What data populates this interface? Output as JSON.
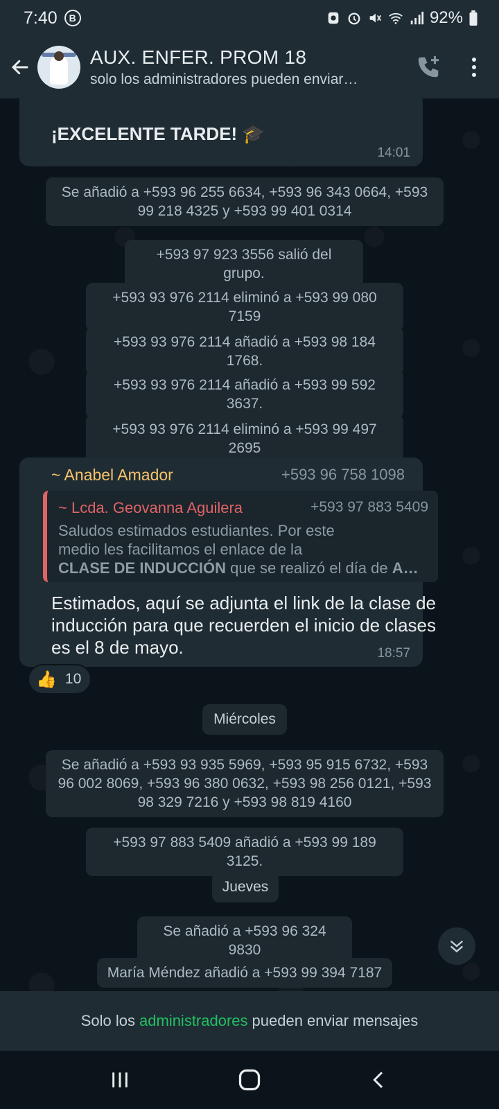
{
  "status": {
    "time": "7:40",
    "b_badge": "B",
    "battery": "92%"
  },
  "header": {
    "title": "AUX. ENFER. PROM 18",
    "subtitle": "solo los administradores pueden enviar…"
  },
  "messages": {
    "m1": {
      "text": "¡EXCELENTE TARDE! 🎓",
      "time": "14:01"
    },
    "sys1": "Se añadió a +593 96 255 6634, +593 96 343 0664, +593 99 218 4325 y +593 99 401 0314",
    "sys2": "+593 97 923 3556 salió del grupo.",
    "sys3": "+593 93 976 2114 eliminó a +593 99 080 7159",
    "sys4": "+593 93 976 2114 añadió a +593 98 184 1768.",
    "sys5": "+593 93 976 2114 añadió a +593 99 592 3637.",
    "sys6": "+593 93 976 2114 eliminó a +593 99 497 2695",
    "m2": {
      "sender": "~ Anabel Amador",
      "sender_phone": "+593 96 758 1098",
      "quote_name": "~ Lcda. Geovanna Aguilera",
      "quote_phone": "+593 97 883 5409",
      "quote_line1": "Saludos estimados estudiantes. Por este",
      "quote_line2": "medio les facilitamos el enlace de la",
      "quote_bold": "CLASE DE INDUCCIÓN",
      "quote_line3": " que se realizó el día de ",
      "quote_end": "A…",
      "text": "Estimados, aquí se adjunta el link de la clase de inducción para que recuerden el inicio de clases es el 8 de mayo.",
      "time": "18:57",
      "reaction_emoji": "👍",
      "reaction_count": "10"
    },
    "day1": "Miércoles",
    "sys7": "Se añadió a +593 93 935 5969, +593 95 915 6732, +593 96 002 8069, +593 96 380 0632, +593 98 256 0121, +593 98 329 7216 y +593 98 819 4160",
    "sys8": "+593 97 883 5409 añadió a +593 99 189 3125.",
    "day2": "Jueves",
    "sys9": "Se añadió a +593 96 324 9830",
    "sys10": "María Méndez añadió a +593 99 394 7187"
  },
  "footer": {
    "pre": "Solo los",
    "link": "administradores",
    "post": "pueden enviar mensajes"
  }
}
